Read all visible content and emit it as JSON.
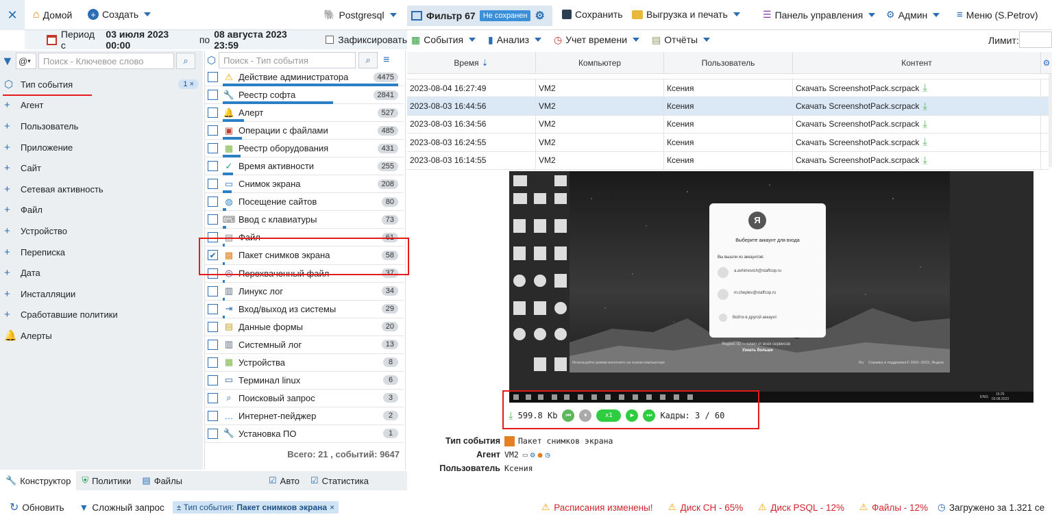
{
  "topbar": {
    "close": "✕",
    "home": "Домой",
    "create": "Создать",
    "db": "Postgresql",
    "filter_title": "Фильтр 67",
    "filter_status": "Не сохранен",
    "save": "Сохранить",
    "export": "Выгрузка и печать",
    "panel": "Панель управления",
    "admin": "Админ",
    "menu": "Меню (S.Petrov)"
  },
  "period": {
    "prefix": "Период с",
    "from": "03 июля 2023 00:00",
    "middle": "по",
    "to": "08 августа 2023 23:59",
    "fix": "Зафиксировать"
  },
  "toolbar2": {
    "events": "События",
    "analysis": "Анализ",
    "time": "Учет времени",
    "reports": "Отчёты",
    "limit": "Лимит:"
  },
  "left": {
    "at": "@",
    "search_placeholder": "Поиск - Ключевое слово",
    "categories": [
      {
        "label": "Тип события",
        "badge": "1 ×"
      },
      {
        "label": "Агент"
      },
      {
        "label": "Пользователь"
      },
      {
        "label": "Приложение"
      },
      {
        "label": "Сайт"
      },
      {
        "label": "Сетевая активность"
      },
      {
        "label": "Файл"
      },
      {
        "label": "Устройство"
      },
      {
        "label": "Переписка"
      },
      {
        "label": "Дата"
      },
      {
        "label": "Инсталляции"
      },
      {
        "label": "Сработавшие политики"
      },
      {
        "label": "Алерты"
      }
    ]
  },
  "middle": {
    "search_placeholder": "Поиск - Тип события",
    "events": [
      {
        "label": "Действие администратора",
        "count": "4475",
        "icon": "⚠",
        "color": "#f0a500",
        "bar": 100
      },
      {
        "label": "Реестр софта",
        "count": "2841",
        "icon": "🔧",
        "color": "#555",
        "bar": 63
      },
      {
        "label": "Алерт",
        "count": "527",
        "icon": "🔔",
        "color": "#f0a500",
        "bar": 12
      },
      {
        "label": "Операции с файлами",
        "count": "485",
        "icon": "▣",
        "color": "#c0392b",
        "bar": 11
      },
      {
        "label": "Реестр оборудования",
        "count": "431",
        "icon": "▦",
        "color": "#7cb342",
        "bar": 10
      },
      {
        "label": "Время активности",
        "count": "255",
        "icon": "✓",
        "color": "#17a589",
        "bar": 6
      },
      {
        "label": "Снимок экрана",
        "count": "208",
        "icon": "▭",
        "color": "#3a7bd5",
        "bar": 5
      },
      {
        "label": "Посещение сайтов",
        "count": "80",
        "icon": "◍",
        "color": "#2e86c1",
        "bar": 2
      },
      {
        "label": "Ввод с клавиатуры",
        "count": "73",
        "icon": "⌨",
        "color": "#777",
        "bar": 2
      },
      {
        "label": "Файл",
        "count": "61",
        "icon": "▤",
        "color": "#888",
        "bar": 1
      },
      {
        "label": "Пакет снимков экрана",
        "count": "58",
        "icon": "▩",
        "color": "#e67e22",
        "bar": 1,
        "checked": true
      },
      {
        "label": "Перехваченный файл",
        "count": "37",
        "icon": "◎",
        "color": "#6c3483",
        "bar": 1
      },
      {
        "label": "Линукс лог",
        "count": "34",
        "icon": "▥",
        "color": "#5d6d7e",
        "bar": 1
      },
      {
        "label": "Вход/выход из системы",
        "count": "29",
        "icon": "⇥",
        "color": "#2a6db5",
        "bar": 1
      },
      {
        "label": "Данные формы",
        "count": "20",
        "icon": "▤",
        "color": "#c9a227",
        "bar": 0
      },
      {
        "label": "Системный лог",
        "count": "13",
        "icon": "▥",
        "color": "#5d6d7e",
        "bar": 0
      },
      {
        "label": "Устройства",
        "count": "8",
        "icon": "▦",
        "color": "#7cb342",
        "bar": 0
      },
      {
        "label": "Терминал linux",
        "count": "6",
        "icon": "▭",
        "color": "#2a6db5",
        "bar": 0
      },
      {
        "label": "Поисковый запрос",
        "count": "3",
        "icon": "⌕",
        "color": "#2a6db5",
        "bar": 0
      },
      {
        "label": "Интернет-пейджер",
        "count": "2",
        "icon": "…",
        "color": "#2a7fd5",
        "bar": 0
      },
      {
        "label": "Установка ПО",
        "count": "1",
        "icon": "🔧",
        "color": "#555",
        "bar": 0
      }
    ],
    "total": "Всего: 21 , событий: 9647"
  },
  "grid": {
    "columns": [
      "Время",
      "Компьютер",
      "Пользователь",
      "Контент"
    ],
    "rows": [
      {
        "time": "2023-08-04 16:27:49",
        "pc": "VM2",
        "user": "Ксения",
        "content": "Скачать ScreenshotPack.scrpack"
      },
      {
        "time": "2023-08-03 16:44:56",
        "pc": "VM2",
        "user": "Ксения",
        "content": "Скачать ScreenshotPack.scrpack",
        "selected": true
      },
      {
        "time": "2023-08-03 16:34:56",
        "pc": "VM2",
        "user": "Ксения",
        "content": "Скачать ScreenshotPack.scrpack"
      },
      {
        "time": "2023-08-03 16:24:55",
        "pc": "VM2",
        "user": "Ксения",
        "content": "Скачать ScreenshotPack.scrpack"
      },
      {
        "time": "2023-08-03 16:14:55",
        "pc": "VM2",
        "user": "Ксения",
        "content": "Скачать ScreenshotPack.scrpack"
      }
    ]
  },
  "viewer": {
    "dialog_logo": "Я",
    "dialog_title": "Выберите аккаунт для входа",
    "dialog_sub": "Вы вышли из аккаунтов:",
    "acc1": "a.avhimovich@staffcop.ru",
    "acc2": "m.cheplev@staffcop.ru",
    "other": "Войти в другой аккаунт",
    "footer1": "Яндекс ID — ключ от всех сервисов",
    "footer2": "Узнать больше",
    "incognito": "Используйте режим инкогнито на чужом компьютере",
    "copyright": "© 2001–2023, Яндекс",
    "help": "Справка и поддержка",
    "lang": "Ru",
    "tray_lang": "ENG",
    "tray_time": "16:25",
    "tray_date": "03.08.2023"
  },
  "player": {
    "size": "599.8 Kb",
    "speed": "x1",
    "frames": "Кадры: 3 / 60"
  },
  "details": {
    "type_label": "Тип события",
    "type_value": "Пакет снимков экрана",
    "agent_label": "Агент",
    "agent_value": "VM2",
    "user_label": "Пользователь",
    "user_value": "Ксения"
  },
  "bottomtabs": {
    "constructor": "Конструктор",
    "policies": "Политики",
    "files": "Файлы",
    "auto": "Авто",
    "stats": "Статистика"
  },
  "statusbar": {
    "refresh": "Обновить",
    "complex": "Сложный запрос",
    "chip_prefix": "± Тип события:",
    "chip_value": "Пакет снимков экрана",
    "chip_close": "×",
    "w1": "Расписания изменены!",
    "w2": "Диск CH - 65%",
    "w3": "Диск PSQL - 12%",
    "w4": "Файлы - 12%",
    "loaded": "Загружено за 1.321 се"
  }
}
